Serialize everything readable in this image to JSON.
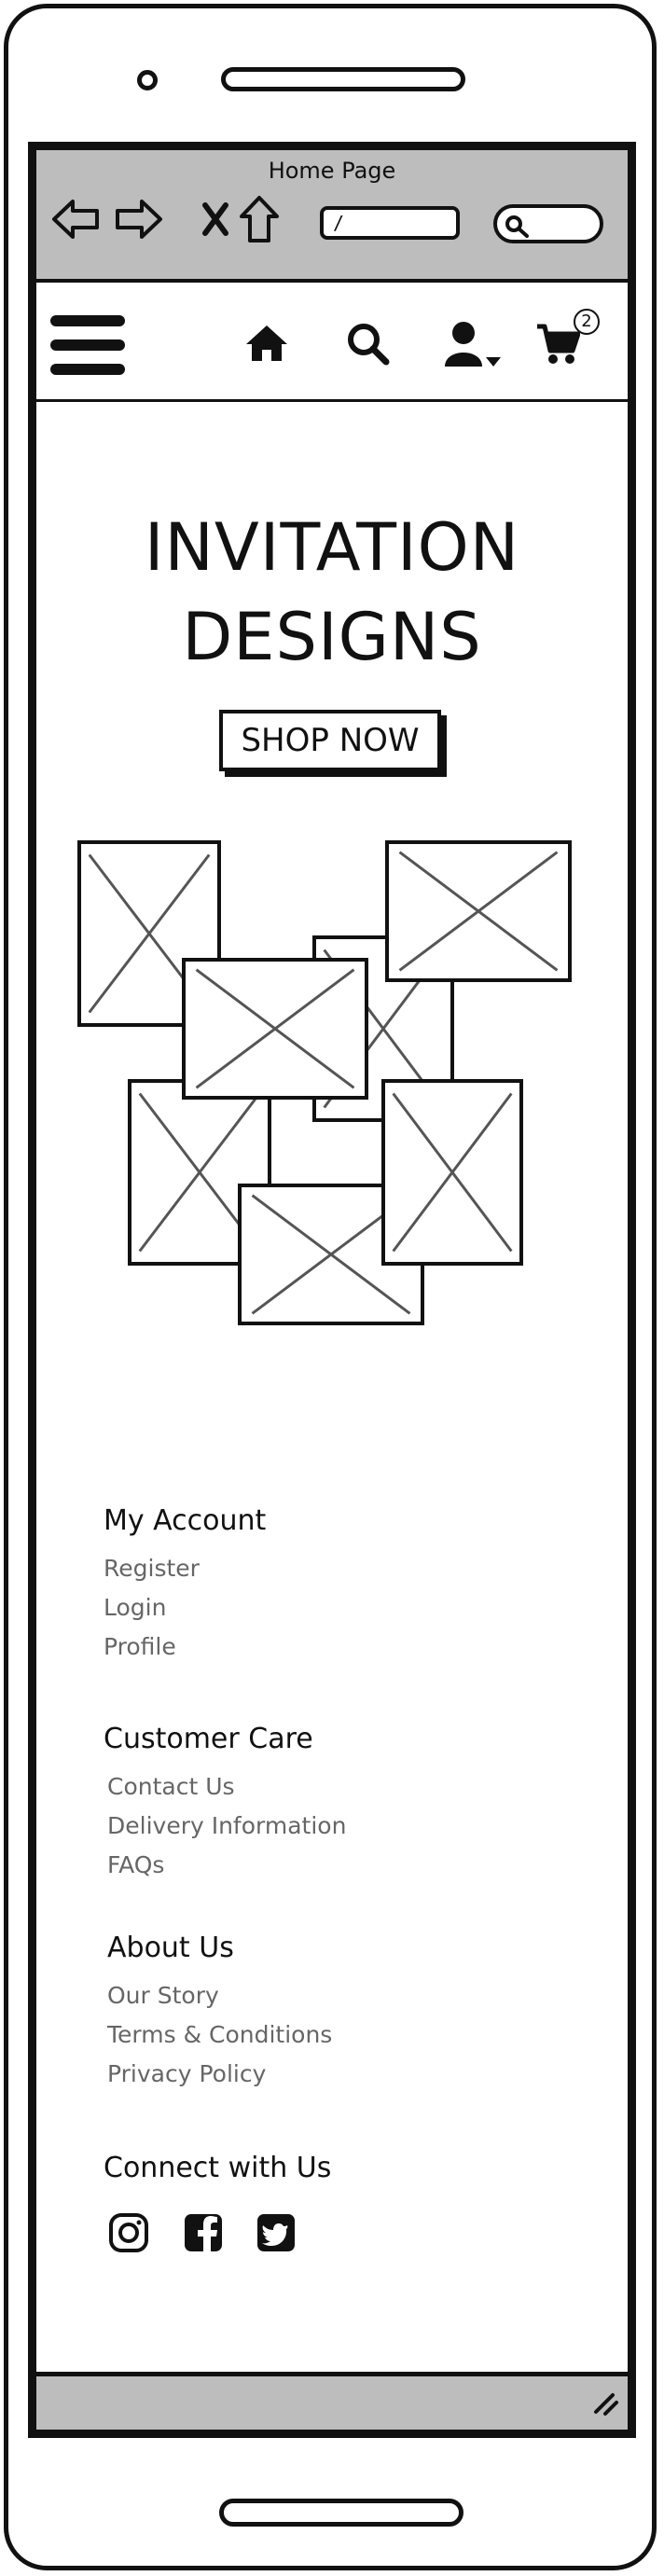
{
  "browser": {
    "title": "Home Page",
    "url": "/",
    "icons": [
      "back-arrow-icon",
      "forward-arrow-icon",
      "close-icon",
      "home-icon",
      "search-icon"
    ]
  },
  "nav": {
    "icons": [
      "hamburger-menu-icon",
      "home-icon",
      "search-icon",
      "user-account-icon",
      "shopping-cart-icon"
    ],
    "cart_count": "2"
  },
  "hero": {
    "title_line1": "INVITATION",
    "title_line2": "DESIGNS",
    "cta_label": "SHOP NOW"
  },
  "footer": {
    "my_account": {
      "heading": "My Account",
      "links": [
        "Register",
        "Login",
        "Profile"
      ]
    },
    "customer_care": {
      "heading": "Customer Care",
      "links": [
        "Contact Us",
        "Delivery Information",
        "FAQs"
      ]
    },
    "about_us": {
      "heading": "About Us",
      "links": [
        "Our Story",
        "Terms & Conditions",
        "Privacy Policy"
      ]
    },
    "connect": {
      "heading": "Connect with Us",
      "icons": [
        "instagram-icon",
        "facebook-icon",
        "twitter-icon"
      ]
    }
  }
}
